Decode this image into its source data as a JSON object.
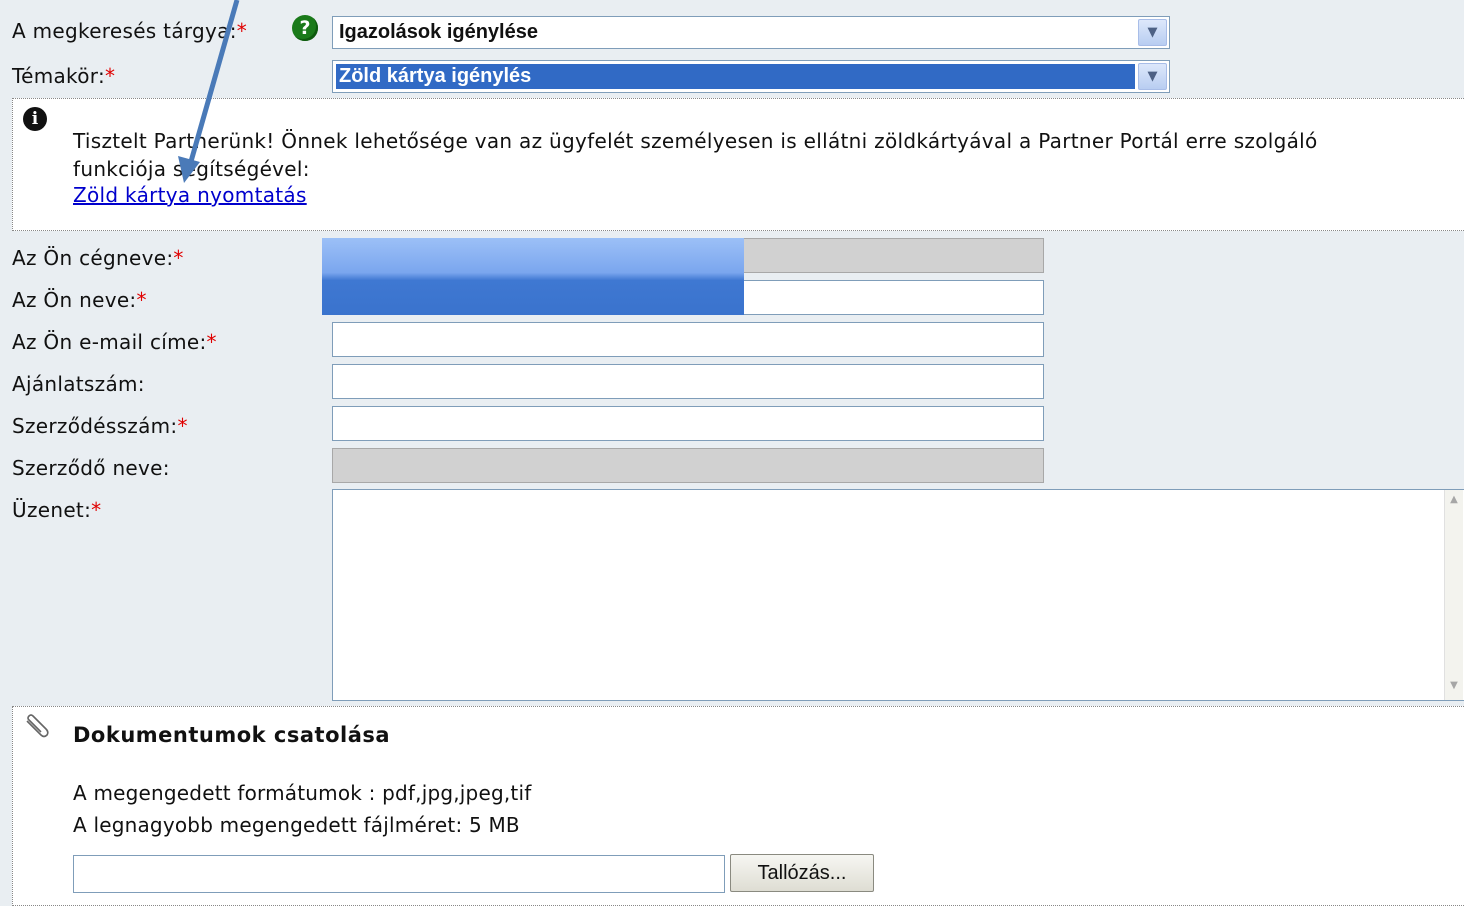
{
  "form": {
    "subject": {
      "label": "A megkeresés tárgya:",
      "required_mark": "*",
      "help_icon": "question-icon",
      "value": "Igazolások igénylése"
    },
    "topic": {
      "label": "Témakör:",
      "required_mark": "*",
      "value": "Zöld kártya igénylés"
    },
    "info": {
      "icon": "info-icon",
      "line1": "Tisztelt Partnerünk! Önnek lehetősége van az ügyfelét személyesen is ellátni zöldkártyával a Partner Portál erre szolgáló",
      "line2": "funkciója segítségével:",
      "link": "Zöld kártya nyomtatás"
    },
    "company_name": {
      "label": "Az Ön cégneve:",
      "required_mark": "*",
      "value": ""
    },
    "your_name": {
      "label": "Az Ön neve:",
      "required_mark": "*",
      "value": ""
    },
    "email": {
      "label": "Az Ön e-mail címe:",
      "required_mark": "*",
      "value": ""
    },
    "offer_number": {
      "label": "Ajánlatszám:",
      "value": ""
    },
    "contract_number": {
      "label": "Szerződésszám:",
      "required_mark": "*",
      "value": ""
    },
    "contractor_name": {
      "label": "Szerződő neve:",
      "value": ""
    },
    "message": {
      "label": "Üzenet:",
      "required_mark": "*",
      "value": ""
    }
  },
  "attachments": {
    "icon": "paperclip-icon",
    "title": "Dokumentumok csatolása",
    "formats": "A megengedett formátumok : pdf,jpg,jpeg,tif",
    "max_size": "A legnagyobb megengedett fájlméret: 5 MB",
    "browse_label": "Tallózás..."
  },
  "colors": {
    "accent": "#316ac5",
    "required": "#e00000",
    "link": "#0000cc",
    "annotation_arrow": "#4a7ab8"
  }
}
